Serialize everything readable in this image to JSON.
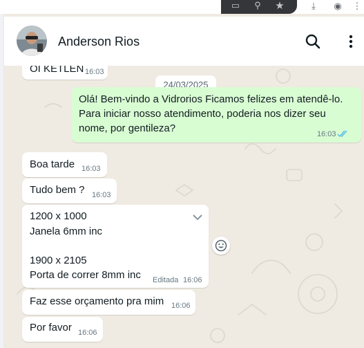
{
  "contact": {
    "name": "Anderson Rios"
  },
  "chat": {
    "date_divider": "24/03/2025",
    "messages": [
      {
        "direction": "in",
        "text": "OI KETLEN",
        "time": "16:03"
      },
      {
        "direction": "out",
        "lines": [
          "Olá! Bem-vindo a Vidrorios Ficamos felizes em atendê-lo.",
          "Para iniciar nosso atendimento, poderia nos dizer seu",
          "nome, por gentileza?"
        ],
        "time": "16:03",
        "status": "read"
      },
      {
        "direction": "in",
        "text": "Boa tarde",
        "time": "16:03"
      },
      {
        "direction": "in",
        "text": "Tudo bem ?",
        "time": "16:03"
      },
      {
        "direction": "in",
        "lines": [
          "1200 x 1000",
          "Janela 6mm inc",
          "",
          "1900 x 2105",
          "Porta de correr 8mm inc"
        ],
        "edited_label": "Editada",
        "time": "16:06"
      },
      {
        "direction": "in",
        "text": "Faz esse orçamento pra mim",
        "time": "16:06"
      },
      {
        "direction": "in",
        "text": "Por favor",
        "time": "16:06"
      }
    ]
  },
  "colors": {
    "outgoing_bubble": "#d9fdd3",
    "incoming_bubble": "#ffffff",
    "read_ticks": "#53bdeb",
    "chat_background": "#efeae2"
  }
}
